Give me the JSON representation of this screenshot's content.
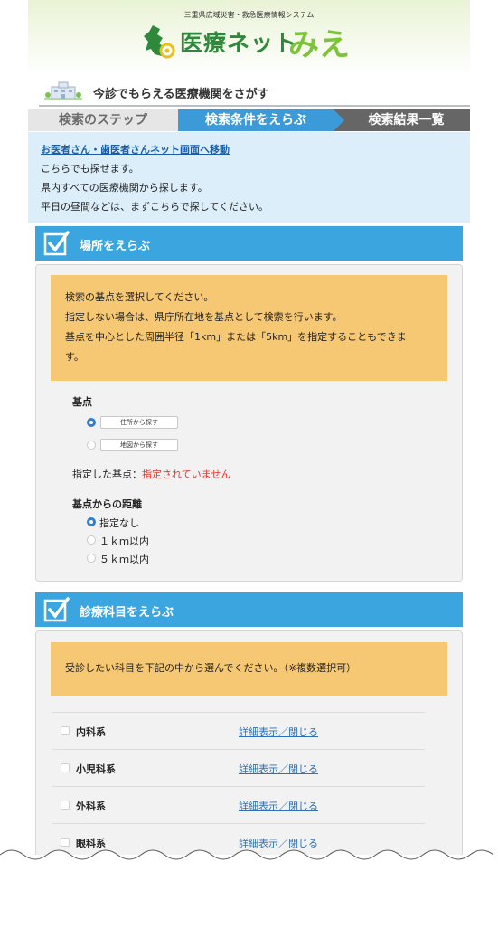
{
  "header": {
    "tagline": "三重県広域災害・救急医療情報システム",
    "logo_text": "医療ネット",
    "logo_script": "みえ"
  },
  "section": {
    "title": "今診でもらえる医療機関をさがす"
  },
  "steps": [
    "検索のステップ",
    "検索条件をえらぶ",
    "検索結果一覧"
  ],
  "info": {
    "link": "お医者さん・歯医者さんネット画面へ移動",
    "lines": [
      "こちらでも探せます。",
      "県内すべての医療機関から探します。",
      "平日の昼間などは、まずこちらで探してください。"
    ]
  },
  "place": {
    "heading": "場所をえらぶ",
    "note_lines": [
      "検索の基点を選択してください。",
      "指定しない場合は、県庁所在地を基点として検索を行います。",
      "基点を中心とした周囲半径「1km」または「5km」を指定することもできま",
      "す。"
    ],
    "base_label": "基点",
    "base_options": [
      {
        "label": "住所から探す",
        "selected": true
      },
      {
        "label": "地図から探す",
        "selected": false
      }
    ],
    "specified_label": "指定した基点：",
    "specified_value": "指定されていません",
    "distance_label": "基点からの距離",
    "distance_options": [
      {
        "label": "指定なし",
        "selected": true
      },
      {
        "label": "１ｋｍ以内",
        "selected": false
      },
      {
        "label": "５ｋｍ以内",
        "selected": false
      }
    ]
  },
  "dept": {
    "heading": "診療科目をえらぶ",
    "note": "受診したい科目を下記の中から選んでください。（※複数選択可）",
    "link_label": "詳細表示／閉じる",
    "items": [
      "内科系",
      "小児科系",
      "外科系",
      "眼科系"
    ]
  },
  "colors": {
    "accent_blue": "#3aa5de",
    "note_orange": "#f7c874",
    "info_bg": "#dbeefa",
    "warning_red": "#e4342c"
  }
}
